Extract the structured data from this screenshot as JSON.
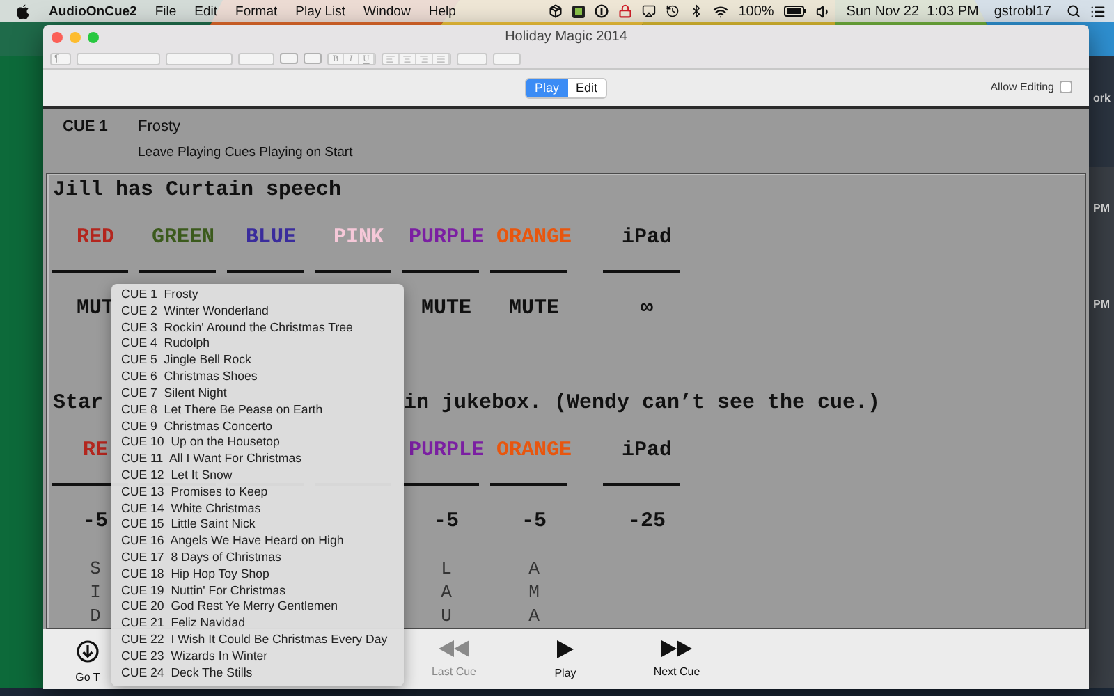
{
  "menu_bar": {
    "app": "AudioOnCue2",
    "menus": [
      "File",
      "Edit",
      "Format",
      "Play List",
      "Window",
      "Help"
    ],
    "battery": "100%",
    "clock": "Sun Nov 22  1:03 PM",
    "user": "gstrobl17"
  },
  "window": {
    "title": "Holiday Magic 2014"
  },
  "format_toolbar": {
    "paragraph": "¶",
    "styles": [
      "B",
      "I",
      "U"
    ]
  },
  "mode_tabs": [
    {
      "label": "Play",
      "selected": true
    },
    {
      "label": "Edit",
      "selected": false
    }
  ],
  "allow_editing": {
    "label": "Allow Editing",
    "checked": false
  },
  "cue_header": {
    "number": "CUE 1",
    "title": "Frosty",
    "note": "Leave Playing Cues Playing on Start"
  },
  "document": {
    "blocks": [
      {
        "kind": "line",
        "text": "Jill has Curtain speech"
      },
      {
        "kind": "blank"
      },
      {
        "kind": "header",
        "cells": [
          {
            "text": "RED",
            "color": "#b3261e"
          },
          {
            "text": "GREEN",
            "color": "#3b5a1c"
          },
          {
            "text": "BLUE",
            "color": "#3a2c9c"
          },
          {
            "text": "PINK",
            "color": "#f5c8d8"
          },
          {
            "text": "PURPLE",
            "color": "#7b1fa2"
          },
          {
            "text": "ORANGE",
            "color": "#e8560e"
          },
          {
            "text": "iPad",
            "color": "#111111"
          }
        ]
      },
      {
        "kind": "rules"
      },
      {
        "kind": "blank"
      },
      {
        "kind": "values",
        "cells": [
          "MUT",
          null,
          null,
          null,
          "MUTE",
          "MUTE",
          "∞"
        ]
      },
      {
        "kind": "blank"
      },
      {
        "kind": "blank"
      },
      {
        "kind": "blank"
      },
      {
        "kind": "split",
        "parts": [
          "Star",
          "in jukebox. (Wendy can’t see the cue.)"
        ]
      },
      {
        "kind": "blank"
      },
      {
        "kind": "header",
        "cells": [
          {
            "text": "RE",
            "color": "#b3261e"
          },
          null,
          null,
          null,
          {
            "text": "PURPLE",
            "color": "#7b1fa2"
          },
          {
            "text": "ORANGE",
            "color": "#e8560e"
          },
          {
            "text": "iPad",
            "color": "#111111"
          }
        ]
      },
      {
        "kind": "rules"
      },
      {
        "kind": "blank"
      },
      {
        "kind": "values",
        "cells": [
          "-5",
          null,
          null,
          null,
          "-5",
          "-5",
          "-25"
        ]
      },
      {
        "kind": "blank"
      },
      {
        "kind": "letters",
        "cells": [
          "S",
          null,
          null,
          null,
          "L",
          "A",
          null
        ]
      },
      {
        "kind": "letters",
        "cells": [
          "I",
          null,
          null,
          null,
          "A",
          "M",
          null
        ]
      },
      {
        "kind": "letters",
        "cells": [
          "D",
          null,
          null,
          null,
          "U",
          "A",
          null
        ]
      }
    ]
  },
  "transport": [
    {
      "label": "Go T",
      "kind": "go",
      "disabled": false
    },
    {
      "label": "Last Cue",
      "kind": "back",
      "disabled": true
    },
    {
      "label": "Play",
      "kind": "play",
      "disabled": false
    },
    {
      "label": "Next Cue",
      "kind": "next",
      "disabled": false
    }
  ],
  "cue_menu": [
    "CUE 1  Frosty",
    "CUE 2  Winter Wonderland",
    "CUE 3  Rockin' Around the Christmas Tree",
    "CUE 4  Rudolph",
    "CUE 5  Jingle Bell Rock",
    "CUE 6  Christmas Shoes",
    "CUE 7  Silent Night",
    "CUE 8  Let There Be Pease on Earth",
    "CUE 9  Christmas Concerto",
    "CUE 10  Up on the Housetop",
    "CUE 11  All I Want For Christmas",
    "CUE 12  Let It Snow",
    "CUE 13  Promises to Keep",
    "CUE 14  White Christmas",
    "CUE 15  Little Saint Nick",
    "CUE 16  Angels We Have Heard on High",
    "CUE 17  8 Days of Christmas",
    "CUE 18  Hip Hop Toy Shop",
    "CUE 19  Nuttin' For Christmas",
    "CUE 20  God Rest Ye Merry Gentlemen",
    "CUE 21  Feliz Navidad",
    "CUE 22  I Wish It Could Be Christmas Every Day",
    "CUE 23  Wizards In Winter",
    "CUE 24  Deck The Stills"
  ],
  "desktop_fragments": [
    "ork",
    "PM",
    "PM"
  ]
}
